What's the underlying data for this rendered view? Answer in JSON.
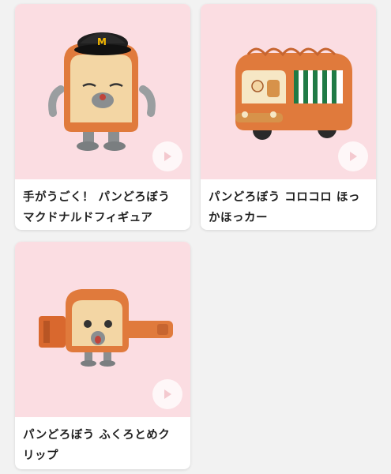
{
  "cards": [
    {
      "title_line1": "手がうごく！ パンどろぼう",
      "title_line2": "マクドナルドフィギュア",
      "image": "bread-thief-figure-with-mcdonalds-cap",
      "icon": "play-icon"
    },
    {
      "title_line1": "パンどろぼう コロコロ ほっ",
      "title_line2": "かほっカー",
      "image": "bread-bus-toy-car",
      "icon": "play-icon"
    },
    {
      "title_line1": "パンどろぼう ふくろとめク",
      "title_line2": "リップ",
      "image": "bread-thief-bag-clip",
      "icon": "play-icon"
    }
  ],
  "colors": {
    "page_background": "#f2f2f2",
    "media_background": "#fbdde2",
    "bread_crust": "#e07a3c",
    "bread_face": "#f3d6a4",
    "text": "#222222"
  }
}
